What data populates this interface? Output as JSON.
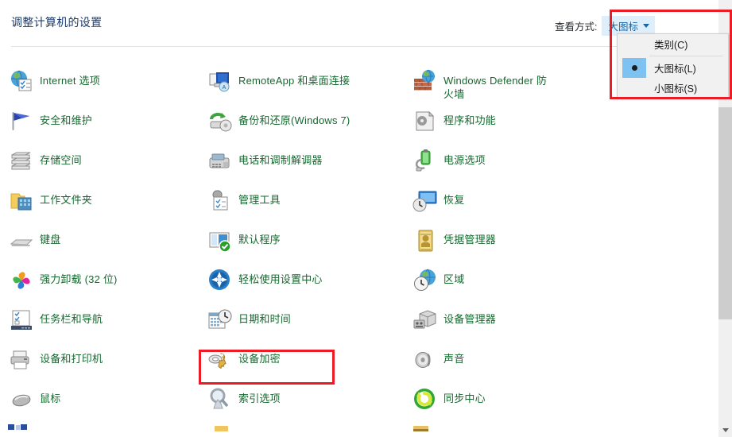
{
  "header": {
    "title": "调整计算机的设置",
    "viewby_label": "查看方式:",
    "viewby_value": "大图标",
    "caret_icon": "chevron-down-icon"
  },
  "viewby_menu": {
    "open": true,
    "options": [
      {
        "label": "类别(C)",
        "selected": false
      },
      {
        "label": "大图标(L)",
        "selected": true
      },
      {
        "label": "小图标(S)",
        "selected": false
      }
    ]
  },
  "colors": {
    "title": "#1b3a6b",
    "link": "#16682f",
    "accent_blue": "#1569a8",
    "viewby_bg": "#dfeefb",
    "highlight_red": "#ed1c24",
    "menu_bg": "#f1f1f1",
    "radio_highlight": "#7dc2f0",
    "scrollbar_track": "#f0f0f0",
    "scrollbar_thumb": "#cdcdcd"
  },
  "items": [
    {
      "label": "Internet 选项",
      "icon": "internet-options-icon",
      "col": 0,
      "row": 0,
      "highlighted": false
    },
    {
      "label": "安全和维护",
      "icon": "security-maintenance-flag-icon",
      "col": 0,
      "row": 1,
      "highlighted": false
    },
    {
      "label": "存储空间",
      "icon": "storage-spaces-icon",
      "col": 0,
      "row": 2,
      "highlighted": false
    },
    {
      "label": "工作文件夹",
      "icon": "work-folders-icon",
      "col": 0,
      "row": 3,
      "highlighted": false
    },
    {
      "label": "键盘",
      "icon": "keyboard-icon",
      "col": 0,
      "row": 4,
      "highlighted": false
    },
    {
      "label": "强力卸载 (32 位)",
      "icon": "powerful-uninstall-icon",
      "col": 0,
      "row": 5,
      "highlighted": false
    },
    {
      "label": "任务栏和导航",
      "icon": "taskbar-navigation-icon",
      "col": 0,
      "row": 6,
      "highlighted": false
    },
    {
      "label": "设备和打印机",
      "icon": "devices-printers-icon",
      "col": 0,
      "row": 7,
      "highlighted": false
    },
    {
      "label": "鼠标",
      "icon": "mouse-icon",
      "col": 0,
      "row": 8,
      "highlighted": false
    },
    {
      "label": "RemoteApp 和桌面连接",
      "icon": "remoteapp-desktop-icon",
      "col": 1,
      "row": 0,
      "highlighted": false
    },
    {
      "label": "备份和还原(Windows 7)",
      "icon": "backup-restore-icon",
      "col": 1,
      "row": 1,
      "highlighted": false
    },
    {
      "label": "电话和调制解调器",
      "icon": "phone-modem-icon",
      "col": 1,
      "row": 2,
      "highlighted": false
    },
    {
      "label": "管理工具",
      "icon": "administrative-tools-icon",
      "col": 1,
      "row": 3,
      "highlighted": false
    },
    {
      "label": "默认程序",
      "icon": "default-programs-icon",
      "col": 1,
      "row": 4,
      "highlighted": false
    },
    {
      "label": "轻松使用设置中心",
      "icon": "ease-of-access-icon",
      "col": 1,
      "row": 5,
      "highlighted": false
    },
    {
      "label": "日期和时间",
      "icon": "date-time-icon",
      "col": 1,
      "row": 6,
      "highlighted": false
    },
    {
      "label": "设备加密",
      "icon": "device-encryption-icon",
      "col": 1,
      "row": 7,
      "highlighted": true
    },
    {
      "label": "索引选项",
      "icon": "indexing-options-icon",
      "col": 1,
      "row": 8,
      "highlighted": false
    },
    {
      "label": "Windows Defender 防火墙",
      "icon": "windows-defender-firewall-icon",
      "col": 2,
      "row": 0,
      "highlighted": false
    },
    {
      "label": "程序和功能",
      "icon": "programs-features-icon",
      "col": 2,
      "row": 1,
      "highlighted": false
    },
    {
      "label": "电源选项",
      "icon": "power-options-icon",
      "col": 2,
      "row": 2,
      "highlighted": false
    },
    {
      "label": "恢复",
      "icon": "recovery-icon",
      "col": 2,
      "row": 3,
      "highlighted": false
    },
    {
      "label": "凭据管理器",
      "icon": "credential-manager-icon",
      "col": 2,
      "row": 4,
      "highlighted": false
    },
    {
      "label": "区域",
      "icon": "region-icon",
      "col": 2,
      "row": 5,
      "highlighted": false
    },
    {
      "label": "设备管理器",
      "icon": "device-manager-icon",
      "col": 2,
      "row": 6,
      "highlighted": false
    },
    {
      "label": "声音",
      "icon": "sound-icon",
      "col": 2,
      "row": 7,
      "highlighted": false
    },
    {
      "label": "同步中心",
      "icon": "sync-center-icon",
      "col": 2,
      "row": 8,
      "highlighted": false
    }
  ],
  "scrollbar": {
    "down_arrow_icon": "chevron-down-icon"
  }
}
